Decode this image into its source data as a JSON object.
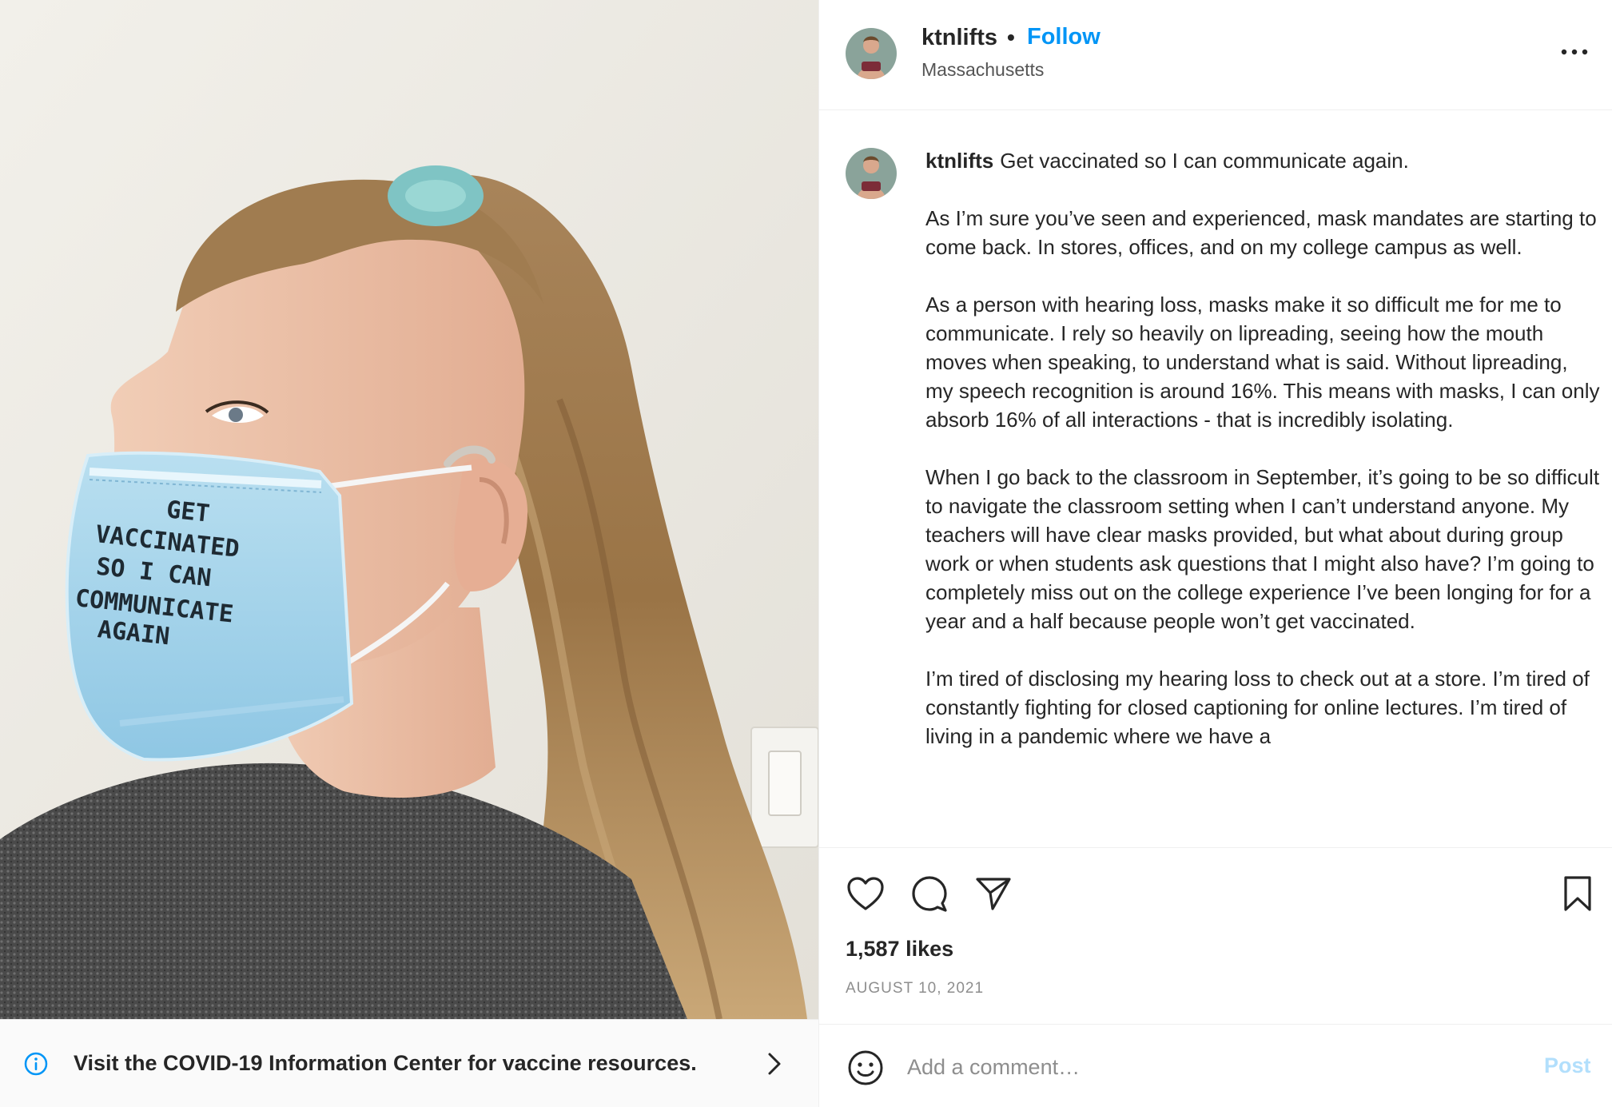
{
  "media": {
    "mask_text_lines": [
      "GET",
      "VACCINATED",
      "SO  I  CAN",
      "COMMUNICATE",
      "AGAIN"
    ]
  },
  "covid_banner": {
    "icon": "info-icon",
    "text": "Visit the COVID-19 Information Center for vaccine resources.",
    "chevron_icon": "chevron-right-icon"
  },
  "header": {
    "username": "ktnlifts",
    "separator": "•",
    "follow_label": "Follow",
    "location": "Massachusetts",
    "more_icon": "more-options-icon"
  },
  "caption": {
    "username": "ktnlifts",
    "first_line": "Get vaccinated so I can communicate again.",
    "paragraphs": [
      "As I’m sure you’ve seen and experienced, mask mandates are starting to come back. In stores, offices, and on my college campus as well.",
      "As a person with hearing loss, masks make it so difficult me for me to communicate. I rely so heavily on lipreading, seeing how the mouth moves when speaking, to understand what is said. Without lipreading, my speech recognition is around 16%. This means with masks, I can only absorb 16% of all interactions - that is incredibly isolating.",
      "When I go back to the classroom in September, it’s going to be so difficult to navigate the classroom setting when I can’t understand anyone. My teachers will have clear masks provided, but what about during group work or when students ask questions that I might also have? I’m going to completely miss out on the college experience I’ve been longing for for a year and a half because people won’t get vaccinated.",
      "I’m tired of disclosing my hearing loss to check out at a store. I’m tired of constantly fighting for closed captioning for online lectures. I’m tired of living in a pandemic where we have a"
    ]
  },
  "actions": {
    "like_icon": "heart-icon",
    "comment_icon": "comment-icon",
    "share_icon": "share-icon",
    "save_icon": "bookmark-icon",
    "likes": "1,587 likes",
    "date": "AUGUST 10, 2021"
  },
  "comment_box": {
    "emoji_icon": "emoji-icon",
    "placeholder": "Add a comment…",
    "post_label": "Post"
  },
  "colors": {
    "accent": "#0095f6",
    "post_disabled": "#b2dffc",
    "text": "#262626",
    "muted": "#8e8e8e",
    "border": "#efefef"
  }
}
